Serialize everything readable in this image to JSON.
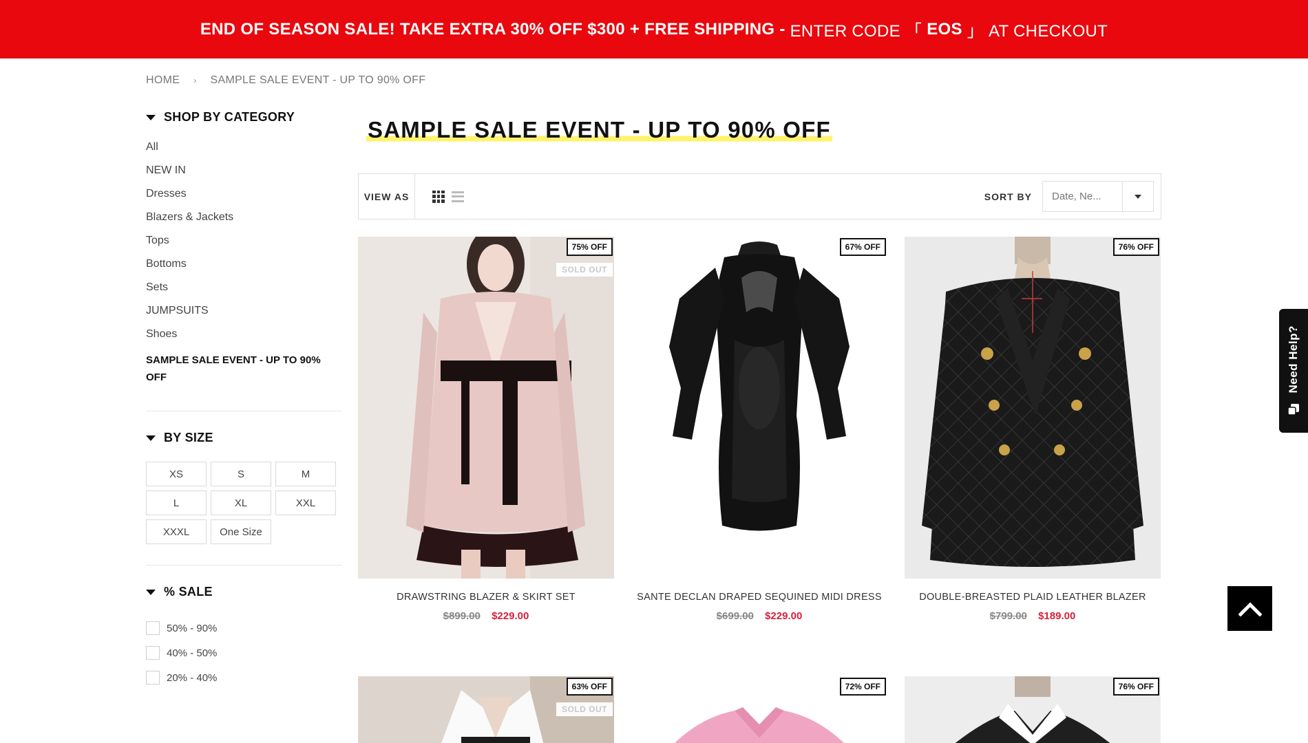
{
  "promo": {
    "bold_text": "END OF SEASON SALE! TAKE EXTRA 30% OFF $300 + FREE SHIPPING - ",
    "regular_text_1": "ENTER CODE 「 ",
    "code": "EOS",
    "regular_text_2": " 」 AT CHECKOUT",
    "bg_color": "#e8080e"
  },
  "breadcrumb": {
    "home": "HOME",
    "current": "SAMPLE SALE EVENT - UP TO 90% OFF"
  },
  "sidebar": {
    "category_heading": "SHOP BY CATEGORY",
    "categories": [
      "All",
      "NEW IN",
      "Dresses",
      "Blazers & Jackets",
      "Tops",
      "Bottoms",
      "Sets",
      "JUMPSUITS",
      "Shoes"
    ],
    "active_category": "SAMPLE SALE EVENT - UP TO 90% OFF",
    "size_heading": "BY SIZE",
    "sizes": [
      "XS",
      "S",
      "M",
      "L",
      "XL",
      "XXL",
      "XXXL",
      "One Size"
    ],
    "sale_heading": "% SALE",
    "sale_ranges": [
      "50% - 90%",
      "40% - 50%",
      "20% - 40%"
    ]
  },
  "page_title": "SAMPLE SALE EVENT - UP TO 90% OFF",
  "toolbar": {
    "view_as": "VIEW AS",
    "sort_by": "SORT BY",
    "sort_value": "Date, Ne..."
  },
  "products": [
    {
      "name": "DRAWSTRING BLAZER & SKIRT SET",
      "old_price": "$899.00",
      "new_price": "$229.00",
      "badge": "75% OFF",
      "soldout": "SOLD OUT"
    },
    {
      "name": "SANTE DECLAN DRAPED SEQUINED MIDI DRESS",
      "old_price": "$699.00",
      "new_price": "$229.00",
      "badge": "67% OFF"
    },
    {
      "name": "DOUBLE-BREASTED PLAID LEATHER BLAZER",
      "old_price": "$799.00",
      "new_price": "$189.00",
      "badge": "76% OFF"
    },
    {
      "badge": "63% OFF",
      "soldout": "SOLD OUT"
    },
    {
      "badge": "72% OFF"
    },
    {
      "badge": "76% OFF"
    }
  ],
  "help": {
    "label": "Need Help?"
  },
  "colors": {
    "sale_price": "#d81f3c",
    "title_highlight": "#fff36b"
  }
}
